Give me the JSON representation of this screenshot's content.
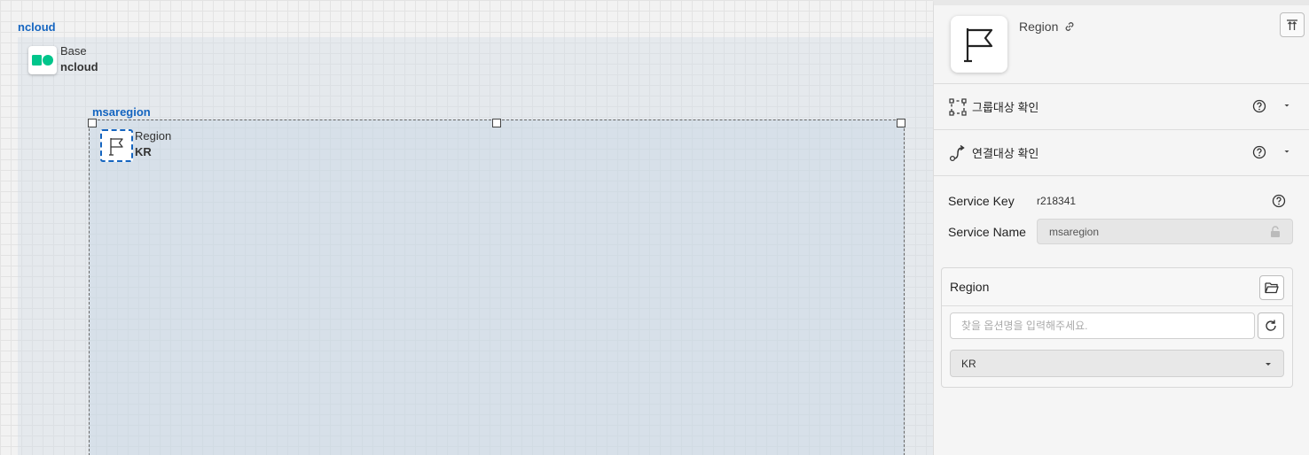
{
  "canvas": {
    "base_group": {
      "title": "ncloud",
      "node_type": "Base",
      "node_name": "ncloud"
    },
    "region_group": {
      "title": "msaregion",
      "node_type": "Region",
      "node_name": "KR"
    }
  },
  "panel": {
    "title": "Region",
    "sections": [
      {
        "label": "그룹대상 확인",
        "icon": "group-bracket-icon"
      },
      {
        "label": "연결대상 확인",
        "icon": "connection-icon"
      }
    ],
    "service_key": {
      "label": "Service Key",
      "value": "r218341"
    },
    "service_name": {
      "label": "Service Name",
      "value": "msaregion"
    },
    "region_card": {
      "title": "Region",
      "search_placeholder": "찾을 옵션명을 입력해주세요.",
      "selected": "KR"
    }
  },
  "colors": {
    "group_title": "#1565c0",
    "base_icon": "#00c58b",
    "selection_border": "#1565c0"
  }
}
